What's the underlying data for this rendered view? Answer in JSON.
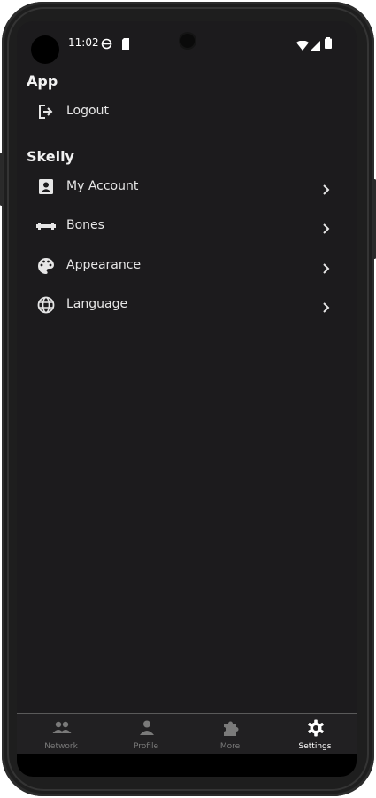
{
  "status_bar": {
    "time": "11:02"
  },
  "sections": [
    {
      "title": "App",
      "items": [
        {
          "label": "Logout",
          "icon": "logout-icon",
          "has_chevron": false
        }
      ]
    },
    {
      "title": "Skelly",
      "items": [
        {
          "label": "My Account",
          "icon": "account-box-icon",
          "has_chevron": true
        },
        {
          "label": "Bones",
          "icon": "bone-icon",
          "has_chevron": true
        },
        {
          "label": "Appearance",
          "icon": "palette-icon",
          "has_chevron": true
        },
        {
          "label": "Language",
          "icon": "globe-icon",
          "has_chevron": true
        }
      ]
    }
  ],
  "bottom_nav": {
    "tabs": [
      {
        "label": "Network",
        "icon": "people-icon",
        "active": false
      },
      {
        "label": "Profile",
        "icon": "person-icon",
        "active": false
      },
      {
        "label": "More",
        "icon": "puzzle-icon",
        "active": false
      },
      {
        "label": "Settings",
        "icon": "gear-icon",
        "active": true
      }
    ]
  },
  "colors": {
    "background": "#1c1b1d",
    "text": "#ececec",
    "inactive_tab": "#7a7a7a",
    "active_tab": "#ffffff"
  }
}
